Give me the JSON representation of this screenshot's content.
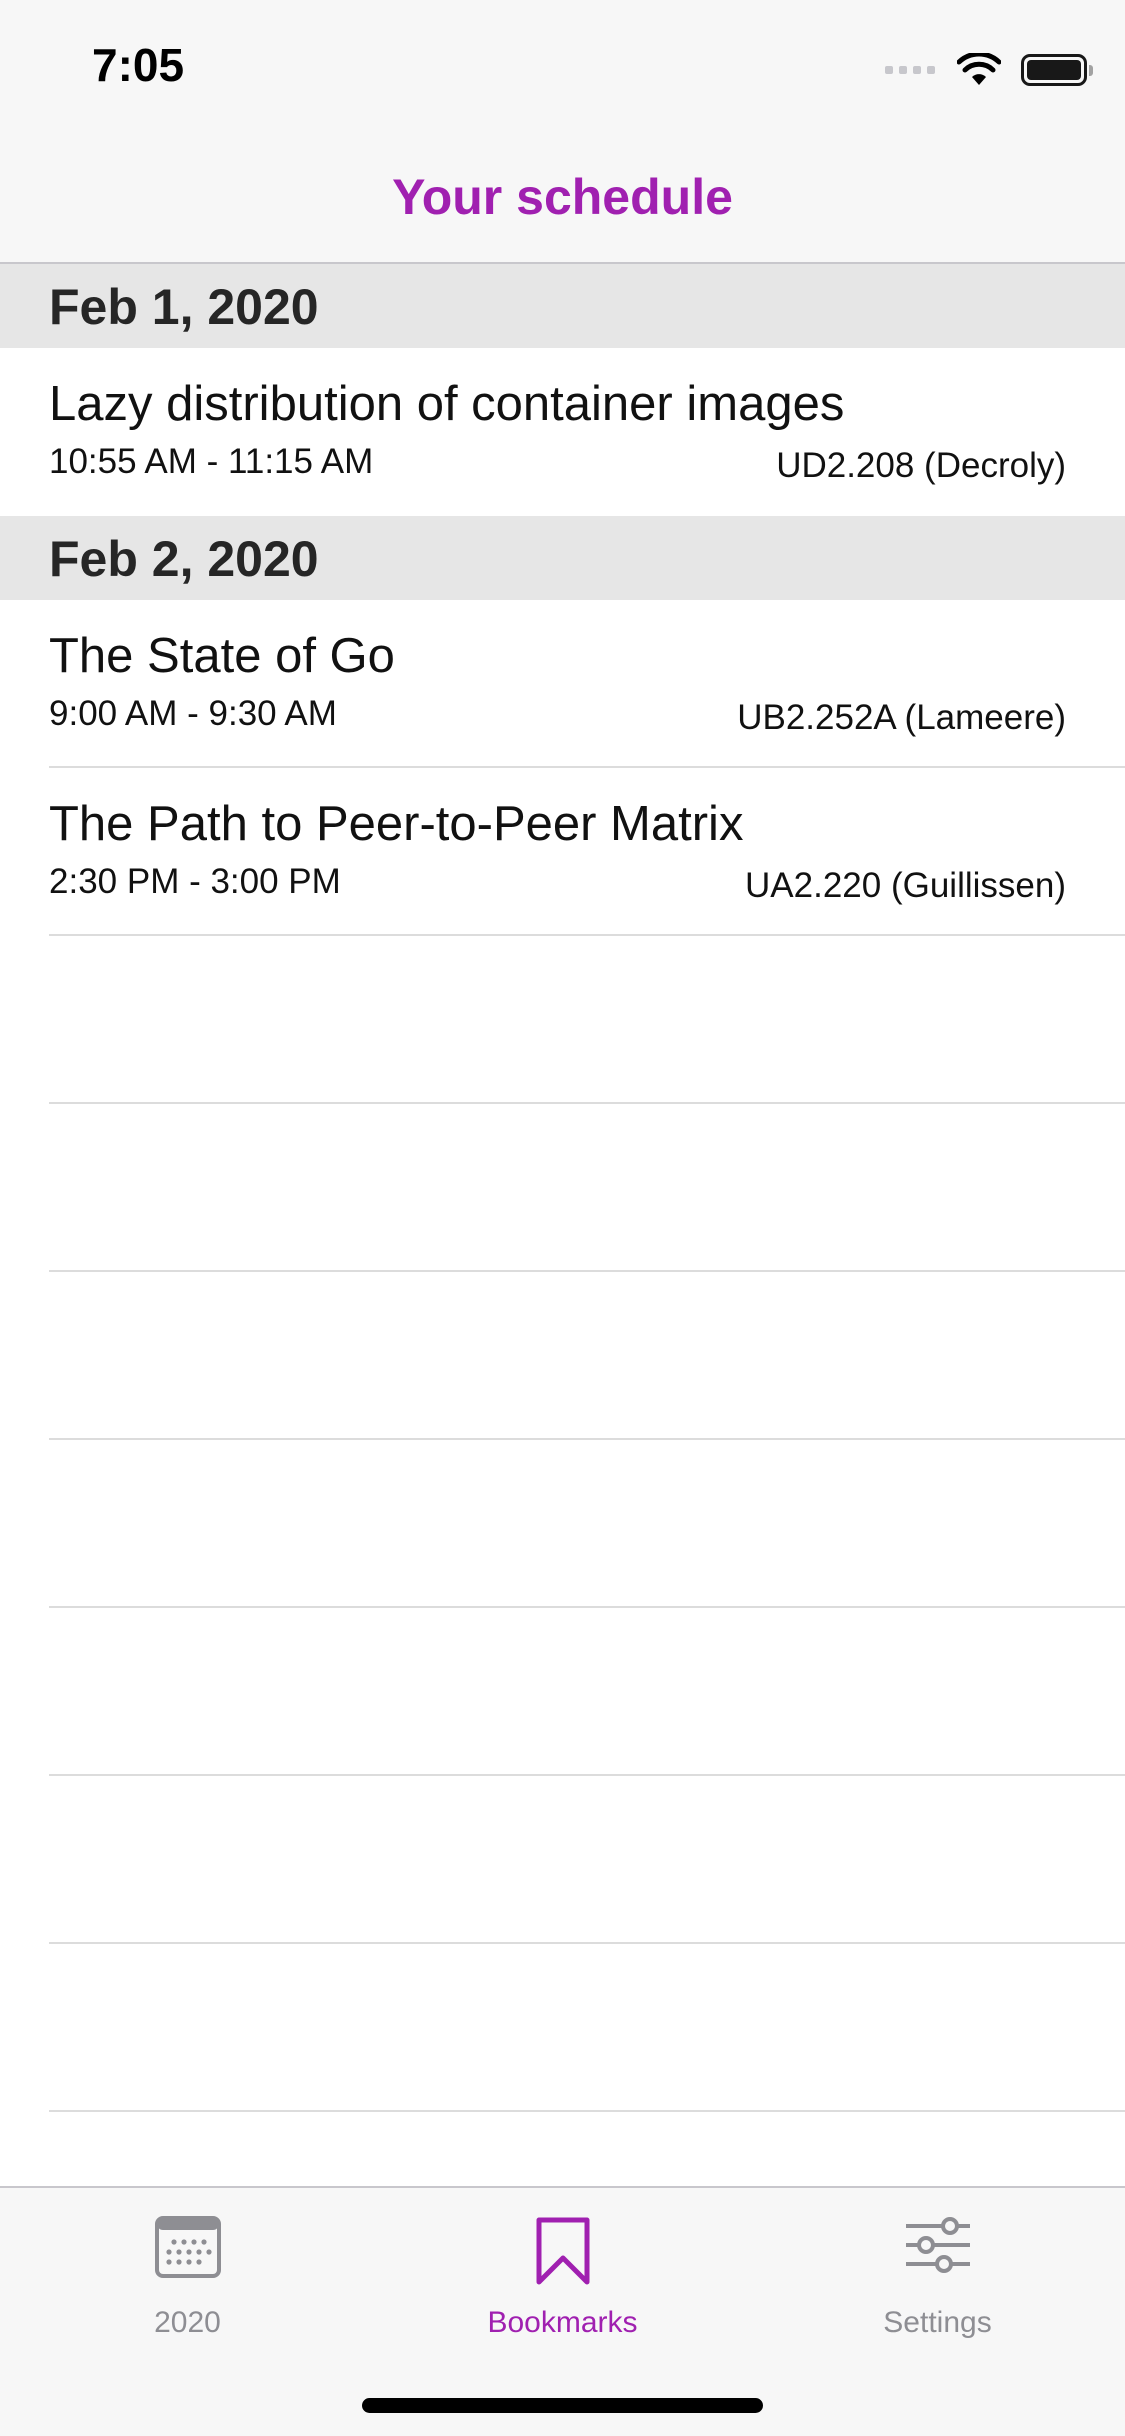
{
  "status_bar": {
    "time": "7:05"
  },
  "nav": {
    "title": "Your schedule"
  },
  "colors": {
    "accent": "#a020b0",
    "section_bg": "#e6e6e6",
    "inactive_tab": "#8e8e93"
  },
  "sections": [
    {
      "date": "Feb 1, 2020",
      "events": [
        {
          "title": "Lazy distribution of container images",
          "time": "10:55 AM - 11:15 AM",
          "room": "UD2.208 (Decroly)"
        }
      ]
    },
    {
      "date": "Feb 2, 2020",
      "events": [
        {
          "title": "The State of Go",
          "time": "9:00 AM - 9:30 AM",
          "room": "UB2.252A (Lameere)"
        },
        {
          "title": "The Path to Peer-to-Peer Matrix",
          "time": "2:30 PM - 3:00 PM",
          "room": "UA2.220 (Guillissen)"
        }
      ]
    }
  ],
  "tabs": [
    {
      "label": "2020",
      "icon": "calendar-icon",
      "active": false
    },
    {
      "label": "Bookmarks",
      "icon": "bookmark-icon",
      "active": true
    },
    {
      "label": "Settings",
      "icon": "sliders-icon",
      "active": false
    }
  ]
}
